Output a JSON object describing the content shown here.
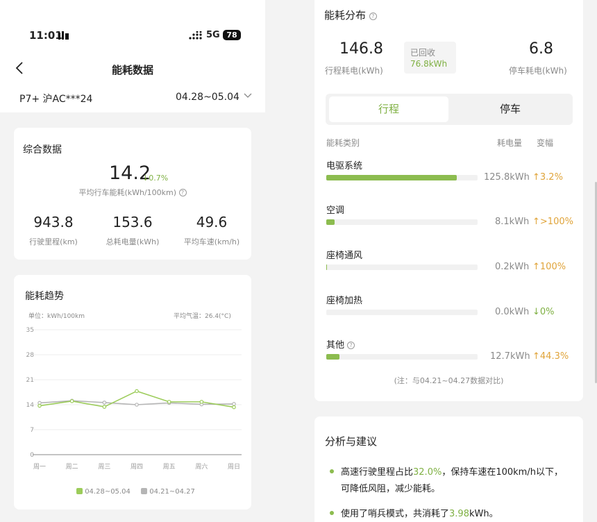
{
  "status": {
    "time": "11:01",
    "network": "5G",
    "battery": "78"
  },
  "header": {
    "title": "能耗数据"
  },
  "vehicle": {
    "plate": "P7+ 沪AC***24",
    "date_range": "04.28~05.04"
  },
  "summary": {
    "title": "综合数据",
    "main_value": "14.2",
    "main_change": "0.7%",
    "main_label": "平均行车能耗(kWh/100km)",
    "stats": [
      {
        "value": "943.8",
        "label": "行驶里程(km)"
      },
      {
        "value": "153.6",
        "label": "总耗电量(kWh)"
      },
      {
        "value": "49.6",
        "label": "平均车速(km/h)"
      }
    ]
  },
  "trend": {
    "title": "能耗趋势",
    "unit_label": "单位：kWh/100km",
    "temp_label": "平均气温：26.4(°C)",
    "legend": [
      "04.28~05.04",
      "04.21~04.27"
    ]
  },
  "chart_data": {
    "type": "line",
    "categories": [
      "周一",
      "周二",
      "周三",
      "周四",
      "周五",
      "周六",
      "周日"
    ],
    "series": [
      {
        "name": "04.28~05.04",
        "color": "#9ccc5a",
        "values": [
          13.7,
          15.0,
          13.4,
          17.8,
          14.8,
          14.8,
          13.3
        ]
      },
      {
        "name": "04.21~04.27",
        "color": "#b5b5b5",
        "values": [
          14.5,
          15.1,
          14.6,
          14.0,
          14.5,
          14.1,
          14.2
        ]
      }
    ],
    "yticks": [
      0,
      7,
      14,
      21,
      28,
      35
    ],
    "ylim": [
      0,
      35
    ],
    "grid": true
  },
  "distribution": {
    "title": "能耗分布",
    "drive_value": "146.8",
    "drive_label": "行程耗电(kWh)",
    "recovered_label": "已回收",
    "recovered_value": "76.8kWh",
    "park_value": "6.8",
    "park_label": "停车耗电(kWh)",
    "tabs": [
      "行程",
      "停车"
    ],
    "col_category": "能耗类别",
    "col_energy": "耗电量",
    "col_change": "变幅",
    "items": [
      {
        "name": "电驱系统",
        "energy": "125.8kWh",
        "change": "3.2%",
        "dir": "up",
        "fraction": 0.864
      },
      {
        "name": "空调",
        "energy": "8.1kWh",
        "change": ">100%",
        "dir": "up",
        "fraction": 0.056
      },
      {
        "name": "座椅通风",
        "energy": "0.2kWh",
        "change": "100%",
        "dir": "up",
        "fraction": 0.004
      },
      {
        "name": "座椅加热",
        "energy": "0.0kWh",
        "change": "0%",
        "dir": "down",
        "fraction": 0.0
      },
      {
        "name": "其他",
        "energy": "12.7kWh",
        "change": "44.3%",
        "dir": "up",
        "fraction": 0.087
      }
    ],
    "note": "(注：与04.21~04.27数据对比)"
  },
  "analysis": {
    "title": "分析与建议",
    "tip1_pre": "高速行驶里程占比",
    "tip1_hl": "32.0%",
    "tip1_post": "，保持车速在100km/h以下，",
    "tip1_line2": "可降低风阻，减少能耗。",
    "tip2_pre": "使用了哨兵模式，共消耗了",
    "tip2_hl": "3.98",
    "tip2_post": "kWh。"
  }
}
